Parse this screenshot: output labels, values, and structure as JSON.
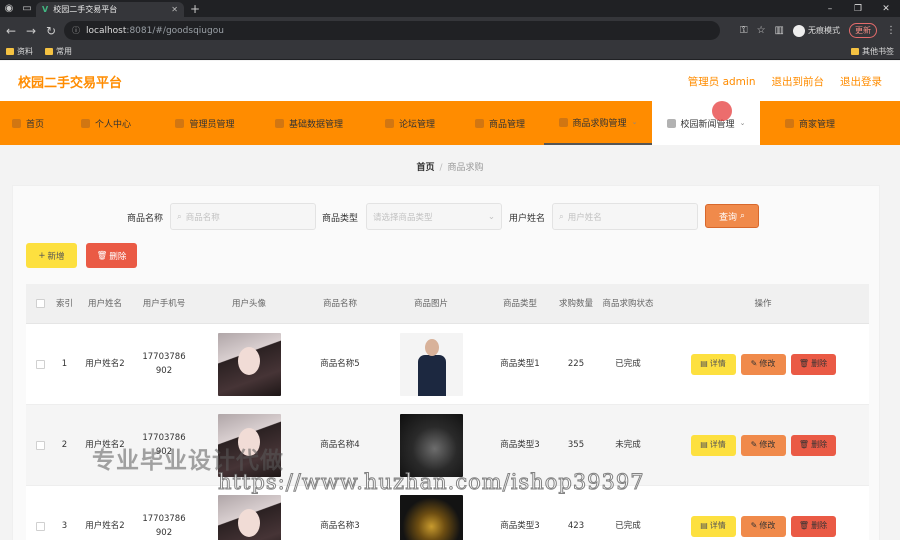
{
  "browser": {
    "tab_title": "校园二手交易平台",
    "url_host": "localhost",
    "url_rest": ":8081/#/goodsqiugou",
    "profile_label": "无痕模式",
    "update_label": "更新",
    "bookmarks": [
      "资料",
      "常用"
    ],
    "bookmarks_right": "其他书签"
  },
  "app": {
    "title": "校园二手交易平台",
    "header_links": [
      "管理员 admin",
      "退出到前台",
      "退出登录"
    ]
  },
  "nav": [
    {
      "label": "首页",
      "icon": "home-icon"
    },
    {
      "label": "个人中心",
      "icon": "user-icon"
    },
    {
      "label": "管理员管理",
      "icon": "admin-icon"
    },
    {
      "label": "基础数据管理",
      "icon": "grid-icon"
    },
    {
      "label": "论坛管理",
      "icon": "forum-icon"
    },
    {
      "label": "商品管理",
      "icon": "goods-icon"
    },
    {
      "label": "商品求购管理",
      "icon": "cart-icon"
    },
    {
      "label": "校园新闻管理",
      "icon": "news-icon"
    },
    {
      "label": "商家管理",
      "icon": "shop-icon"
    }
  ],
  "breadcrumb": {
    "home": "首页",
    "current": "商品求购"
  },
  "filters": {
    "name_label": "商品名称",
    "name_placeholder": "商品名称",
    "type_label": "商品类型",
    "type_placeholder": "请选择商品类型",
    "user_label": "用户姓名",
    "user_placeholder": "用户姓名",
    "query_label": "查询"
  },
  "actions": {
    "add_label": "新增",
    "delete_label": "删除"
  },
  "table": {
    "headers": [
      "索引",
      "用户姓名",
      "用户手机号",
      "用户头像",
      "商品名称",
      "商品图片",
      "商品类型",
      "求购数量",
      "商品求购状态",
      "操作"
    ],
    "op_labels": {
      "detail": "详情",
      "edit": "修改",
      "remove": "删除"
    },
    "rows": [
      {
        "index": "1",
        "user": "用户姓名2",
        "phone": "17703786902",
        "avatar": "girl",
        "goods": "商品名称5",
        "image": "man",
        "type": "商品类型1",
        "qty": "225",
        "status": "已完成"
      },
      {
        "index": "2",
        "user": "用户姓名2",
        "phone": "17703786902",
        "avatar": "girl",
        "goods": "商品名称4",
        "image": "laptop",
        "type": "商品类型3",
        "qty": "355",
        "status": "未完成"
      },
      {
        "index": "3",
        "user": "用户姓名2",
        "phone": "17703786902",
        "avatar": "girl",
        "goods": "商品名称3",
        "image": "jewel",
        "type": "商品类型3",
        "qty": "423",
        "status": "已完成"
      }
    ]
  },
  "watermark": {
    "text": "专业毕业设计代做",
    "url": "https://www.huzhan.com/ishop39397"
  }
}
